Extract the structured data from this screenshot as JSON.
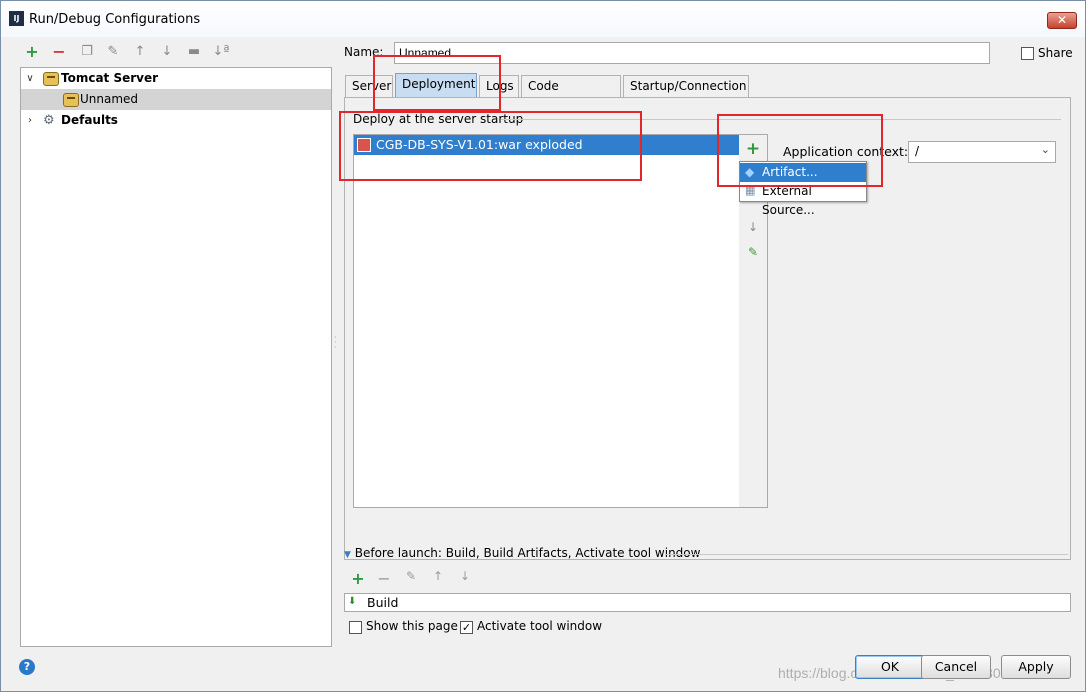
{
  "window": {
    "title": "Run/Debug Configurations",
    "icon": "intellij-icon",
    "close_label": "✕"
  },
  "left_toolbar": {
    "icons": [
      "add-icon",
      "remove-icon",
      "copy-icon",
      "wrench-icon",
      "move-up-icon",
      "move-down-icon",
      "folder-icon",
      "sort-icon"
    ]
  },
  "tree": {
    "items": [
      {
        "label": "Tomcat Server",
        "icon": "tomcat-icon",
        "expanded": true,
        "bold": true
      },
      {
        "label": "Unnamed",
        "icon": "tomcat-icon",
        "selected": true
      },
      {
        "label": "Defaults",
        "icon": "wrench-icon",
        "expanded": false,
        "bold": true
      }
    ]
  },
  "name_field": {
    "label": "Name:",
    "value": "Unnamed"
  },
  "share": {
    "label": "Share",
    "checked": false
  },
  "tabs": [
    {
      "label": "Server",
      "active": false
    },
    {
      "label": "Deployment",
      "active": true
    },
    {
      "label": "Logs",
      "active": false
    },
    {
      "label": "Code Coverage",
      "active": false
    },
    {
      "label": "Startup/Connection",
      "active": false
    }
  ],
  "deployment": {
    "section_label": "Deploy at the server startup",
    "items": [
      {
        "label": "CGB-DB-SYS-V1.01:war exploded",
        "icon": "war-artifact-icon"
      }
    ],
    "side_tools": [
      "add-icon",
      "remove-icon",
      "move-down-icon",
      "edit-icon"
    ],
    "popup": [
      {
        "label": "Artifact...",
        "icon": "artifact-icon",
        "selected": true
      },
      {
        "label": "External Source...",
        "icon": "external-source-icon",
        "selected": false
      }
    ],
    "app_context": {
      "label": "Application context:",
      "value": "/"
    }
  },
  "before_launch": {
    "label": "Before launch: Build, Build Artifacts, Activate tool window",
    "tools": [
      "add-icon",
      "remove-icon",
      "edit-icon",
      "move-up-icon",
      "move-down-icon"
    ],
    "items": [
      {
        "label": "Build",
        "icon": "build-icon"
      }
    ]
  },
  "options": {
    "show_page": {
      "label": "Show this page",
      "checked": false
    },
    "activate_tool": {
      "label": "Activate tool window",
      "checked": true
    }
  },
  "buttons": {
    "help": "?",
    "ok": "OK",
    "cancel": "Cancel",
    "apply": "Apply"
  },
  "watermark": "https://blog.csdn.net/weixin_45063087",
  "colors": {
    "selection": "#2f7fce",
    "highlight_box": "#e3252c",
    "tab_active": "#c8dcf2"
  }
}
